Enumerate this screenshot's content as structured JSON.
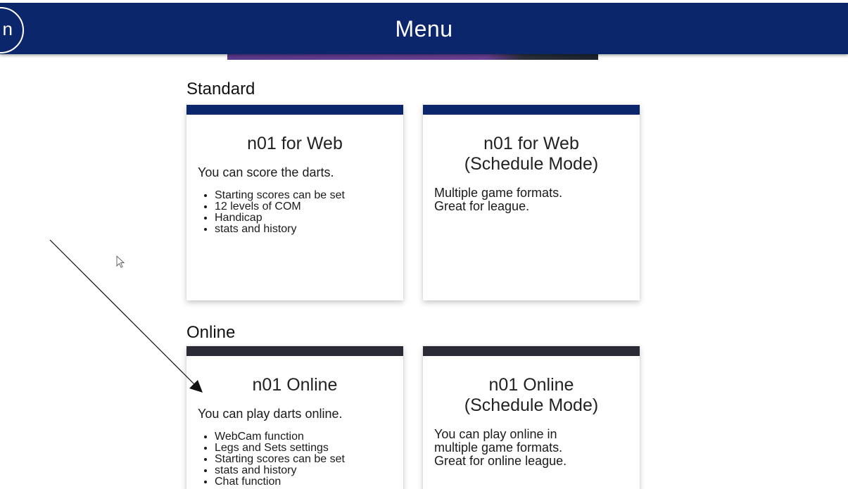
{
  "header": {
    "title": "Menu",
    "button_glyph": "n"
  },
  "sections": [
    {
      "title": "Standard",
      "cards": [
        {
          "title": "n01 for Web",
          "desc": "You can score the darts.",
          "items": [
            "Starting scores can be set",
            "12 levels of COM",
            "Handicap",
            "stats and history"
          ]
        },
        {
          "title_line1": "n01 for Web",
          "title_line2": "(Schedule Mode)",
          "desc_line1": "Multiple game formats.",
          "desc_line2": "Great for league."
        }
      ]
    },
    {
      "title": "Online",
      "cards": [
        {
          "title": "n01 Online",
          "desc": "You can play darts online.",
          "items": [
            "WebCam function",
            "Legs and Sets settings",
            "Starting scores can be set",
            "stats and history",
            "Chat function"
          ]
        },
        {
          "title_line1": "n01 Online",
          "title_line2": "(Schedule Mode)",
          "desc_line1": "You can play online in",
          "desc_line2": "multiple game formats.",
          "desc_line3": "Great for online league."
        }
      ]
    }
  ],
  "icons": {
    "cursor": "mouse-pointer-icon",
    "arrow": "annotation-arrow-icon"
  },
  "colors": {
    "header": "#0b266a",
    "standard_bar": "#0b266a",
    "online_bar": "#2b2b38"
  }
}
